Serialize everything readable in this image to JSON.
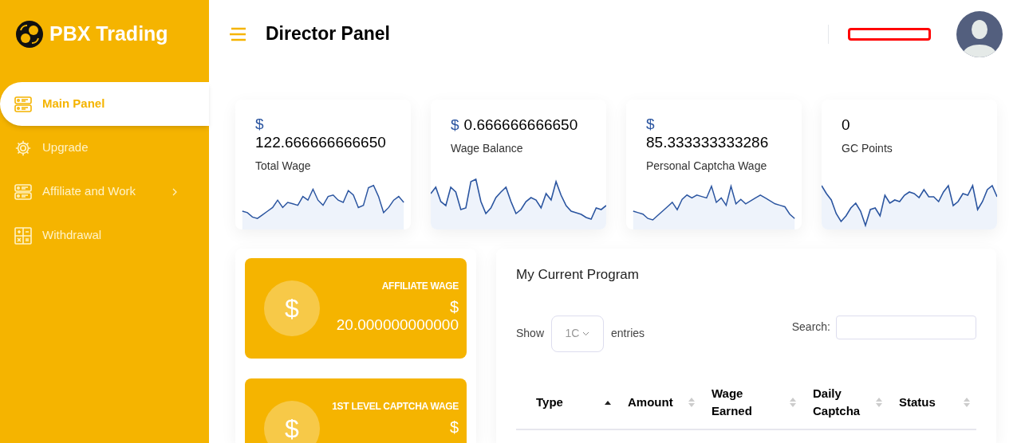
{
  "brand": {
    "name": "PBX Trading"
  },
  "header": {
    "title": "Director Panel"
  },
  "sidebar": {
    "items": [
      {
        "label": "Main Panel",
        "kind": "panel",
        "selected": true,
        "has_submenu": false
      },
      {
        "label": "Upgrade",
        "kind": "gear",
        "selected": false,
        "has_submenu": false
      },
      {
        "label": "Affiliate and Work",
        "kind": "panel",
        "selected": false,
        "has_submenu": true
      },
      {
        "label": "Withdrawal",
        "kind": "calc",
        "selected": false,
        "has_submenu": false
      }
    ]
  },
  "stats": [
    {
      "currency": "$",
      "value": "122.666666666650",
      "label": "Total Wage",
      "inline": false
    },
    {
      "currency": "$",
      "value": "0.666666666650",
      "label": "Wage Balance",
      "inline": true
    },
    {
      "currency": "$",
      "value": "85.333333333286",
      "label": "Personal Captcha Wage",
      "inline": false
    },
    {
      "value": "0",
      "label": "GC Points"
    }
  ],
  "wage_cards": [
    {
      "icon_text": "$",
      "title": "AFFILIATE WAGE",
      "currency": "$",
      "value": "20.000000000000"
    },
    {
      "icon_text": "$",
      "title": "1ST LEVEL CAPTCHA WAGE",
      "currency": "$"
    }
  ],
  "program": {
    "title": "My Current Program",
    "show_label": "Show",
    "page_size": "1C",
    "entries_label": "entries",
    "search_label": "Search:",
    "columns": [
      {
        "label": "Type",
        "kind": "sorted"
      },
      {
        "label": "Amount",
        "kind": "sortable"
      },
      {
        "label": "Wage Earned",
        "kind": "sortable"
      },
      {
        "label": "Daily Captcha",
        "kind": "sortable"
      },
      {
        "label": "Status",
        "kind": "sortable"
      }
    ]
  }
}
